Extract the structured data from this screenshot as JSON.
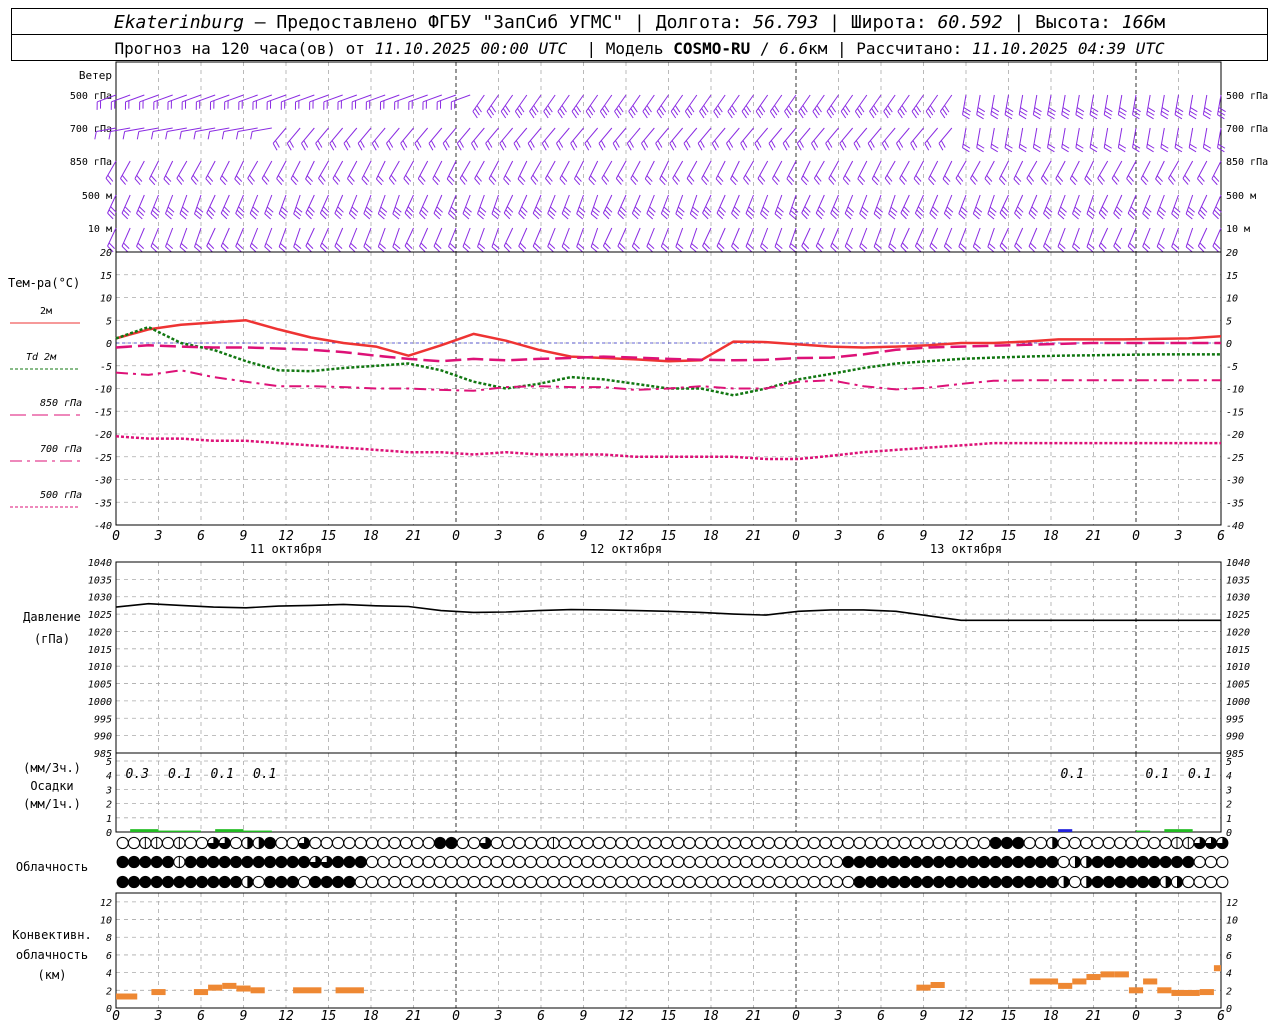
{
  "header": {
    "city": "Ekaterinburg",
    "provider": "– Предоставлено ФГБУ \"ЗапСиб УГМС\"",
    "lon_label": "Долгота:",
    "lon": "56.793",
    "lat_label": "Широта:",
    "lat": "60.592",
    "alt_label": "Высота:",
    "alt": "166",
    "alt_unit": "м",
    "forecast_prefix": "Прогноз на 120 часа(ов) от",
    "forecast_date": "11.10.2025 00:00 UTC",
    "model_label": "Модель",
    "model": "COSMO-RU",
    "model_res": "6.6",
    "model_res_unit": "км",
    "calc_label": "Рассчитано:",
    "calc_date": "11.10.2025 04:39 UTC"
  },
  "labels": {
    "wind": "Ветер",
    "wind_levels": [
      "500 гПа",
      "700 гПа",
      "850 гПа",
      "500 м",
      "10 м"
    ],
    "temp_title": "Тем-ра(°C)",
    "temp_legend": [
      "2м",
      "Td 2м",
      "850 гПа",
      "700 гПа",
      "500 гПа"
    ],
    "pressure_title": [
      "Давление",
      "(гПа)"
    ],
    "precip_title": [
      "(мм/3ч.)",
      "Осадки",
      "(мм/1ч.)"
    ],
    "cloud_title": "Облачность",
    "conv_title": [
      "Конвективн.",
      "облачность",
      "(км)"
    ],
    "dates": [
      "11 октября",
      "12 октября",
      "13 октября"
    ]
  },
  "colors": {
    "wind": "#8a2be2",
    "t2m": "#ee3333",
    "td2m": "#117711",
    "t850": "#dd1177",
    "t700": "#dd1177",
    "t500": "#dd1177",
    "pressure": "#000000",
    "precip_rain": "#22bb22",
    "precip_snow": "#2222dd",
    "conv": "#ee8833",
    "zero_line": "#3333cc",
    "grid": "#aaaaaa"
  },
  "chart_data": {
    "type": "line",
    "x_hours": [
      0,
      3,
      6,
      9,
      12,
      15,
      18,
      21,
      24,
      27,
      30,
      33,
      36,
      39,
      42,
      45,
      48,
      51,
      54,
      57,
      60,
      63,
      66,
      69,
      72,
      75,
      78,
      81,
      84,
      87,
      90,
      93,
      96,
      99,
      102
    ],
    "x_tick_labels": [
      "0",
      "3",
      "6",
      "9",
      "12",
      "15",
      "18",
      "21",
      "0",
      "3",
      "6",
      "9",
      "12",
      "15",
      "18",
      "21",
      "0",
      "3",
      "6",
      "9",
      "12",
      "15",
      "18",
      "21",
      "0",
      "3",
      "6"
    ],
    "temperature": {
      "ylim": [
        -40,
        20
      ],
      "yticks": [
        20,
        15,
        10,
        5,
        0,
        -5,
        -10,
        -15,
        -20,
        -25,
        -30,
        -35,
        -40
      ],
      "series": [
        {
          "name": "2м",
          "values": [
            1,
            3,
            4,
            4.5,
            5,
            3,
            1.2,
            0,
            -0.8,
            -2.8,
            -0.5,
            2,
            0.5,
            -1.5,
            -3,
            -3.3,
            -3.6,
            -4,
            -3.8,
            0.3,
            0.2,
            -0.3,
            -0.8,
            -1,
            -0.8,
            -0.5,
            0,
            0,
            0.3,
            0.8,
            0.8,
            0.8,
            0.9,
            1,
            1.5
          ]
        },
        {
          "name": "Td 2м",
          "values": [
            1,
            3.5,
            0,
            -1.5,
            -4,
            -6,
            -6.2,
            -5.5,
            -5,
            -4.5,
            -6,
            -8.5,
            -10,
            -9,
            -7.5,
            -8,
            -9,
            -10,
            -10,
            -11.5,
            -10,
            -8,
            -6.8,
            -5.5,
            -4.5,
            -4,
            -3.5,
            -3.2,
            -3,
            -2.8,
            -2.7,
            -2.6,
            -2.5,
            -2.5,
            -2.5
          ]
        },
        {
          "name": "850 гПа",
          "values": [
            -1,
            -0.5,
            -0.8,
            -1,
            -1,
            -1.2,
            -1.5,
            -2,
            -2.8,
            -3.5,
            -4,
            -3.5,
            -3.8,
            -3.5,
            -3.3,
            -3,
            -3.2,
            -3.5,
            -3.7,
            -3.8,
            -3.7,
            -3.3,
            -3.2,
            -2.5,
            -1.5,
            -1.0,
            -0.8,
            -0.6,
            -0.4,
            -0.2,
            0,
            0,
            0,
            0,
            0
          ]
        },
        {
          "name": "700 гПа",
          "values": [
            -6.5,
            -7,
            -6,
            -7.5,
            -8.5,
            -9.5,
            -9.5,
            -9.7,
            -10,
            -10,
            -10.3,
            -10.5,
            -9.7,
            -9.5,
            -9.7,
            -9.7,
            -10.3,
            -10,
            -9.5,
            -10,
            -10,
            -8.5,
            -8.2,
            -9.5,
            -10.2,
            -9.8,
            -9.0,
            -8.3,
            -8.2,
            -8.2,
            -8.2,
            -8.2,
            -8.2,
            -8.2,
            -8.2
          ]
        },
        {
          "name": "500 гПа",
          "values": [
            -20.5,
            -21,
            -21,
            -21.5,
            -21.5,
            -22,
            -22.5,
            -23,
            -23.5,
            -24,
            -24,
            -24.5,
            -24,
            -24.5,
            -24.5,
            -24.5,
            -25,
            -25,
            -25,
            -25,
            -25.5,
            -25.5,
            -24.8,
            -24,
            -23.5,
            -23,
            -22.5,
            -22,
            -22,
            -22,
            -22,
            -22,
            -22,
            -22,
            -22
          ]
        }
      ]
    },
    "pressure": {
      "ylim": [
        985,
        1040
      ],
      "yticks": [
        1040,
        1035,
        1030,
        1025,
        1020,
        1015,
        1010,
        1005,
        1000,
        995,
        990,
        985
      ],
      "values": [
        1027,
        1028,
        1027.5,
        1027,
        1026.8,
        1027.3,
        1027.5,
        1027.8,
        1027.4,
        1027.2,
        1026,
        1025.5,
        1025.6,
        1026,
        1026.3,
        1026.2,
        1026,
        1025.8,
        1025.5,
        1025,
        1024.7,
        1025.8,
        1026.2,
        1026.2,
        1025.8,
        1024.5,
        1023.2,
        1023.2,
        1023.2,
        1023.2,
        1023.2,
        1023.2,
        1023.2,
        1023.2,
        1023.2
      ]
    },
    "precip": {
      "ylim": [
        0,
        5
      ],
      "yticks": [
        5,
        4,
        3,
        2,
        1,
        0
      ],
      "labels": [
        {
          "hour": 1.5,
          "text": "0.3"
        },
        {
          "hour": 4.5,
          "text": "0.1"
        },
        {
          "hour": 7.5,
          "text": "0.1"
        },
        {
          "hour": 10.5,
          "text": "0.1"
        },
        {
          "hour": 67.5,
          "text": "0.1"
        },
        {
          "hour": 73.5,
          "text": "0.1"
        },
        {
          "hour": 76.5,
          "text": "0.1"
        }
      ],
      "bars": [
        {
          "start": 1,
          "end": 3,
          "value": 0.2,
          "kind": "rain"
        },
        {
          "start": 3,
          "end": 6,
          "value": 0.1,
          "kind": "rain"
        },
        {
          "start": 7,
          "end": 9,
          "value": 0.2,
          "kind": "rain"
        },
        {
          "start": 9,
          "end": 11,
          "value": 0.1,
          "kind": "rain"
        },
        {
          "start": 66.5,
          "end": 67.5,
          "value": 0.2,
          "kind": "snow"
        },
        {
          "start": 72,
          "end": 73,
          "value": 0.1,
          "kind": "rain"
        },
        {
          "start": 74,
          "end": 76,
          "value": 0.2,
          "kind": "rain"
        }
      ]
    },
    "cloud_rows": [
      "00110100330224003000000000005500300000100000000000000000000000000000000000000555002000000000011333",
      "44444144444444444334440000000000000000000000000000000000000000004444444444444444444022444444444",
      "44444444444204440444400000000000000000000000000000000000000000000444444444444444444202444444220"
    ],
    "convective": {
      "ylim": [
        0,
        13
      ],
      "yticks": [
        12,
        10,
        8,
        6,
        4,
        2,
        0
      ],
      "segments": [
        {
          "start": 0,
          "end": 1.5,
          "value": 1.3
        },
        {
          "start": 2.5,
          "end": 3.5,
          "value": 1.8
        },
        {
          "start": 5.5,
          "end": 6.5,
          "value": 1.8
        },
        {
          "start": 6.5,
          "end": 7.5,
          "value": 2.3
        },
        {
          "start": 7.5,
          "end": 8.5,
          "value": 2.5
        },
        {
          "start": 8.5,
          "end": 9.5,
          "value": 2.2
        },
        {
          "start": 9.5,
          "end": 10.5,
          "value": 2.0
        },
        {
          "start": 12.5,
          "end": 14.5,
          "value": 2.0
        },
        {
          "start": 15.5,
          "end": 17.5,
          "value": 2.0
        },
        {
          "start": 56.5,
          "end": 57.5,
          "value": 2.3
        },
        {
          "start": 57.5,
          "end": 58.5,
          "value": 2.6
        },
        {
          "start": 64.5,
          "end": 66.5,
          "value": 3.0
        },
        {
          "start": 66.5,
          "end": 67.5,
          "value": 2.5
        },
        {
          "start": 67.5,
          "end": 68.5,
          "value": 3.0
        },
        {
          "start": 68.5,
          "end": 69.5,
          "value": 3.5
        },
        {
          "start": 69.5,
          "end": 70.5,
          "value": 3.8
        },
        {
          "start": 70.5,
          "end": 71.5,
          "value": 3.8
        },
        {
          "start": 71.5,
          "end": 72.5,
          "value": 2.0
        },
        {
          "start": 72.5,
          "end": 73.5,
          "value": 3.0
        },
        {
          "start": 73.5,
          "end": 74.5,
          "value": 2.0
        },
        {
          "start": 74.5,
          "end": 76.5,
          "value": 1.7
        },
        {
          "start": 76.5,
          "end": 77.5,
          "value": 1.8
        },
        {
          "start": 77.5,
          "end": 78,
          "value": 4.5
        }
      ]
    },
    "wind_levels_count": 5
  }
}
